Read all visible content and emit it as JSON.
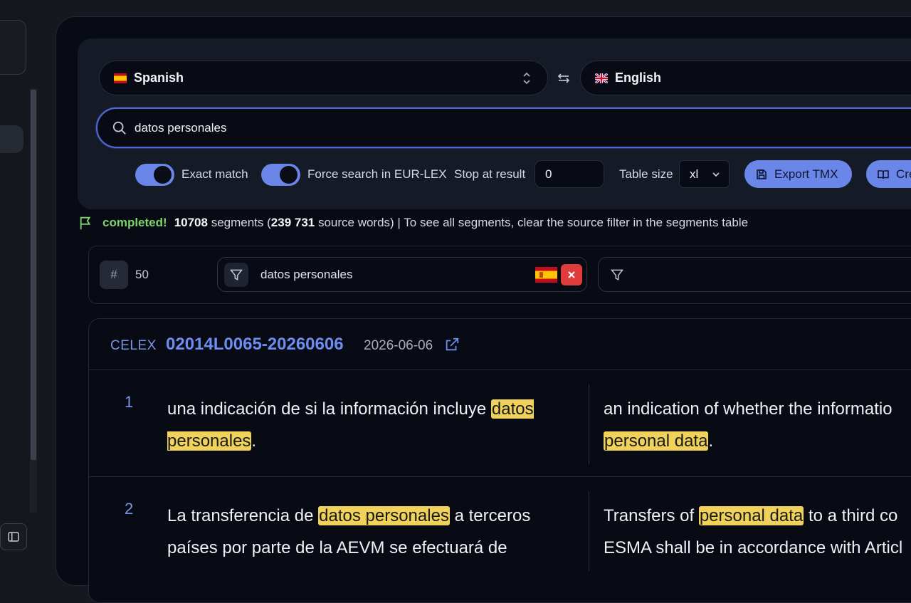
{
  "source_lang": {
    "name": "Spanish",
    "flag": "es-flag-icon"
  },
  "target_lang": {
    "name": "English",
    "flag": "gb-flag-icon"
  },
  "search": {
    "query": "datos personales"
  },
  "options": {
    "exact_match_label": "Exact match",
    "exact_match_on": true,
    "force_eurlex_label": "Force search in EUR-LEX",
    "force_eurlex_on": true,
    "stop_at_label": "Stop at result",
    "stop_at_value": "0",
    "table_size_label": "Table size",
    "table_size_value": "xl",
    "export_label": "Export TMX",
    "create_label": "Cre"
  },
  "status": {
    "state": "completed!",
    "segments": "10708",
    "segments_word": " segments (",
    "words": "239 731",
    "words_suffix": " source words) | To see all segments, clear the source filter in the segments table"
  },
  "filters": {
    "hash": "#",
    "count": "50",
    "source_filter": "datos personales",
    "target_filter": ""
  },
  "document": {
    "celex_label": "CELEX",
    "celex_id": "02014L0065-20260606",
    "date": "2026-06-06"
  },
  "segments": [
    {
      "num": "1",
      "src_pre": "una indicación de si la información incluye ",
      "src_hl": "datos personales",
      "src_post": ".",
      "tgt_line1": "an indication of whether the informatio",
      "tgt_hl": "personal data",
      "tgt_post": "."
    },
    {
      "num": "2",
      "src_pre": "La transferencia de ",
      "src_hl": "datos personales",
      "src_post": " a terceros países por parte de la AEVM se efectuará de",
      "tgt_pre": "Transfers of ",
      "tgt_hl": "personal data",
      "tgt_post": " to a third co",
      "tgt_line2": "ESMA shall be in accordance with Articl"
    }
  ],
  "colors": {
    "accent": "#6a86e8",
    "highlight": "#f0d25a",
    "success": "#7ed36a",
    "danger": "#e03c3c",
    "background": "#080b14"
  }
}
